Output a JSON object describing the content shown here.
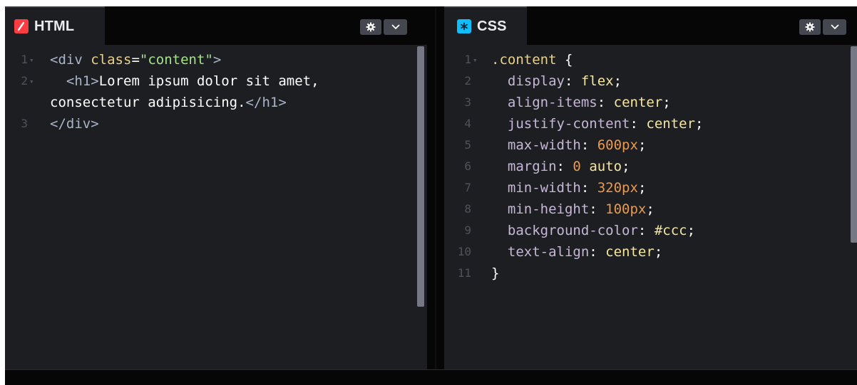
{
  "editors": {
    "html": {
      "title": "HTML",
      "icon": "html-slash-icon",
      "accent": "#ff3c41",
      "lines": [
        {
          "num": "1",
          "parts": [
            [
              "tag",
              "<"
            ],
            [
              "tagname",
              "div"
            ],
            [
              "punc",
              " "
            ],
            [
              "attr",
              "class"
            ],
            [
              "punc",
              "="
            ],
            [
              "str",
              "\"content\""
            ],
            [
              "tag",
              ">"
            ]
          ]
        },
        {
          "num": "2",
          "parts": [
            [
              "punc",
              "  "
            ],
            [
              "tag",
              "<"
            ],
            [
              "tagname",
              "h1"
            ],
            [
              "tag",
              ">"
            ],
            [
              "punc",
              "Lorem ipsum dolor sit amet,"
            ]
          ]
        },
        {
          "num": "",
          "parts": [
            [
              "punc",
              "consectetur adipisicing."
            ],
            [
              "tag",
              "</"
            ],
            [
              "tagname",
              "h1"
            ],
            [
              "tag",
              ">"
            ]
          ]
        },
        {
          "num": "3",
          "parts": [
            [
              "tag",
              "</"
            ],
            [
              "tagname",
              "div"
            ],
            [
              "tag",
              ">"
            ]
          ]
        }
      ]
    },
    "css": {
      "title": "CSS",
      "icon": "css-asterisk-icon",
      "accent": "#0ebeff",
      "lines": [
        {
          "num": "1",
          "parts": [
            [
              "sel",
              ".content"
            ],
            [
              "punc",
              " {"
            ]
          ]
        },
        {
          "num": "2",
          "parts": [
            [
              "punc",
              "  "
            ],
            [
              "prop",
              "display"
            ],
            [
              "punc",
              ": "
            ],
            [
              "kw",
              "flex"
            ],
            [
              "punc",
              ";"
            ]
          ]
        },
        {
          "num": "3",
          "parts": [
            [
              "punc",
              "  "
            ],
            [
              "prop",
              "align-items"
            ],
            [
              "punc",
              ": "
            ],
            [
              "kw",
              "center"
            ],
            [
              "punc",
              ";"
            ]
          ]
        },
        {
          "num": "4",
          "parts": [
            [
              "punc",
              "  "
            ],
            [
              "prop",
              "justify-content"
            ],
            [
              "punc",
              ": "
            ],
            [
              "kw",
              "center"
            ],
            [
              "punc",
              ";"
            ]
          ]
        },
        {
          "num": "5",
          "parts": [
            [
              "punc",
              "  "
            ],
            [
              "prop",
              "max-width"
            ],
            [
              "punc",
              ": "
            ],
            [
              "num",
              "600px"
            ],
            [
              "punc",
              ";"
            ]
          ]
        },
        {
          "num": "6",
          "parts": [
            [
              "punc",
              "  "
            ],
            [
              "prop",
              "margin"
            ],
            [
              "punc",
              ": "
            ],
            [
              "num",
              "0"
            ],
            [
              "punc",
              " "
            ],
            [
              "kw",
              "auto"
            ],
            [
              "punc",
              ";"
            ]
          ]
        },
        {
          "num": "7",
          "parts": [
            [
              "punc",
              "  "
            ],
            [
              "prop",
              "min-width"
            ],
            [
              "punc",
              ": "
            ],
            [
              "num",
              "320px"
            ],
            [
              "punc",
              ";"
            ]
          ]
        },
        {
          "num": "8",
          "parts": [
            [
              "punc",
              "  "
            ],
            [
              "prop",
              "min-height"
            ],
            [
              "punc",
              ": "
            ],
            [
              "num",
              "100px"
            ],
            [
              "punc",
              ";"
            ]
          ]
        },
        {
          "num": "9",
          "parts": [
            [
              "punc",
              "  "
            ],
            [
              "prop",
              "background-color"
            ],
            [
              "punc",
              ": "
            ],
            [
              "kw",
              "#ccc"
            ],
            [
              "punc",
              ";"
            ]
          ]
        },
        {
          "num": "10",
          "parts": [
            [
              "punc",
              "  "
            ],
            [
              "prop",
              "text-align"
            ],
            [
              "punc",
              ": "
            ],
            [
              "kw",
              "center"
            ],
            [
              "punc",
              ";"
            ]
          ]
        },
        {
          "num": "11",
          "parts": [
            [
              "punc",
              "}"
            ]
          ]
        }
      ]
    }
  },
  "toolbar": {
    "settings_icon": "gear-icon",
    "dropdown_icon": "chevron-down-icon"
  }
}
